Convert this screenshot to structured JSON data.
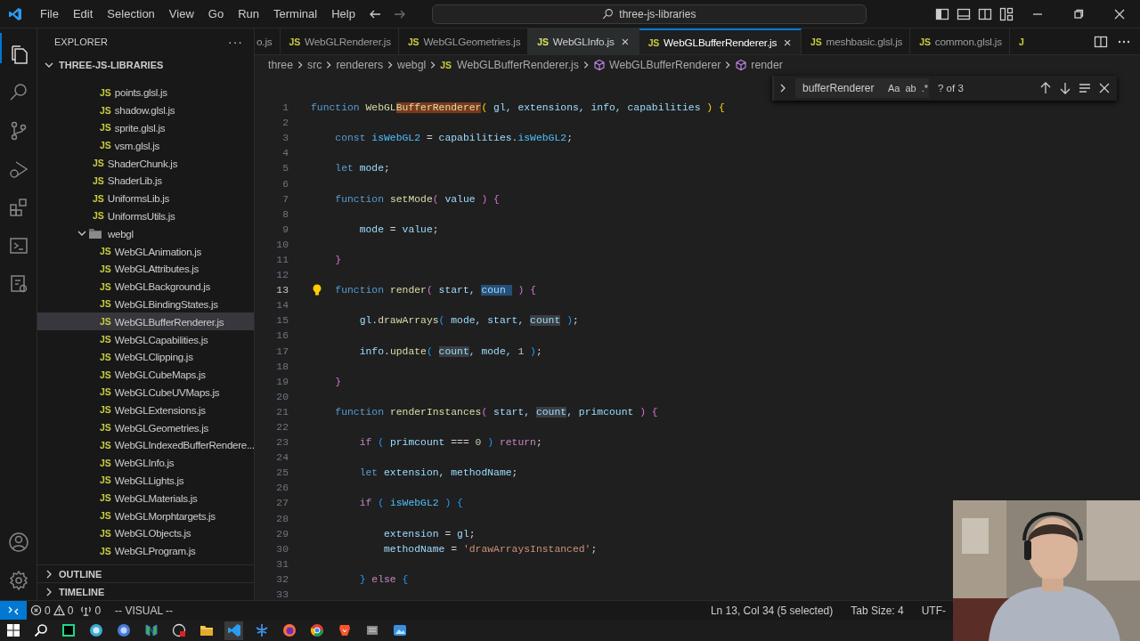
{
  "menu": [
    "File",
    "Edit",
    "Selection",
    "View",
    "Go",
    "Run",
    "Terminal",
    "Help"
  ],
  "command_center": {
    "label": "three-js-libraries"
  },
  "sidebar": {
    "title": "EXPLORER",
    "more": "···",
    "section": {
      "label": "THREE-JS-LIBRARIES",
      "expanded": true
    },
    "tree": [
      {
        "children": [
          {
            "name": "points.glsl.js",
            "badge": "JS",
            "selected": false
          },
          {
            "name": "shadow.glsl.js",
            "badge": "JS",
            "selected": false
          },
          {
            "name": "sprite.glsl.js",
            "badge": "JS",
            "selected": false
          },
          {
            "name": "vsm.glsl.js",
            "badge": "JS",
            "selected": false
          }
        ]
      },
      {
        "name": "ShaderChunk.js",
        "badge": "JS",
        "selected": false
      },
      {
        "name": "ShaderLib.js",
        "badge": "JS",
        "selected": false
      },
      {
        "name": "UniformsLib.js",
        "badge": "JS",
        "selected": false
      },
      {
        "name": "UniformsUtils.js",
        "badge": "JS",
        "selected": false
      },
      {
        "name": "webgl",
        "kind": "folder",
        "expanded": true,
        "selected": false,
        "children": [
          {
            "name": "WebGLAnimation.js",
            "badge": "JS",
            "selected": false
          },
          {
            "name": "WebGLAttributes.js",
            "badge": "JS",
            "selected": false
          },
          {
            "name": "WebGLBackground.js",
            "badge": "JS",
            "selected": false
          },
          {
            "name": "WebGLBindingStates.js",
            "badge": "JS",
            "selected": false
          },
          {
            "name": "WebGLBufferRenderer.js",
            "badge": "JS",
            "selected": true
          },
          {
            "name": "WebGLCapabilities.js",
            "badge": "JS",
            "selected": false
          },
          {
            "name": "WebGLClipping.js",
            "badge": "JS",
            "selected": false
          },
          {
            "name": "WebGLCubeMaps.js",
            "badge": "JS",
            "selected": false
          },
          {
            "name": "WebGLCubeUVMaps.js",
            "badge": "JS",
            "selected": false
          },
          {
            "name": "WebGLExtensions.js",
            "badge": "JS",
            "selected": false
          },
          {
            "name": "WebGLGeometries.js",
            "badge": "JS",
            "selected": false
          },
          {
            "name": "WebGLIndexedBufferRendere...",
            "badge": "JS",
            "selected": false
          },
          {
            "name": "WebGLInfo.js",
            "badge": "JS",
            "selected": false
          },
          {
            "name": "WebGLLights.js",
            "badge": "JS",
            "selected": false
          },
          {
            "name": "WebGLMaterials.js",
            "badge": "JS",
            "selected": false
          },
          {
            "name": "WebGLMorphtargets.js",
            "badge": "JS",
            "selected": false
          },
          {
            "name": "WebGLObjects.js",
            "badge": "JS",
            "selected": false
          },
          {
            "name": "WebGLProgram.js",
            "badge": "JS",
            "selected": false
          }
        ]
      }
    ],
    "panels": [
      {
        "label": "OUTLINE",
        "expanded": false
      },
      {
        "label": "TIMELINE",
        "expanded": false
      }
    ]
  },
  "tabs": [
    {
      "label": "o.js",
      "selected": false,
      "hovered": false
    },
    {
      "badge": "JS",
      "label": "WebGLRenderer.js",
      "selected": false,
      "hovered": false
    },
    {
      "badge": "JS",
      "label": "WebGLGeometries.js",
      "selected": false,
      "hovered": false
    },
    {
      "badge": "JS",
      "label": "WebGLInfo.js",
      "selected": false,
      "hovered": true,
      "close": "×"
    },
    {
      "badge": "JS",
      "label": "WebGLBufferRenderer.js",
      "selected": true,
      "hovered": false,
      "close": "×"
    },
    {
      "badge": "JS",
      "label": "meshbasic.glsl.js",
      "selected": false,
      "hovered": false
    },
    {
      "badge": "JS",
      "label": "common.glsl.js",
      "selected": false,
      "hovered": false
    },
    {
      "badge": "J",
      "selected": false,
      "hovered": false
    }
  ],
  "breadcrumbs": [
    {
      "kind": "folder",
      "label": "three"
    },
    {
      "kind": "folder",
      "label": "src"
    },
    {
      "kind": "folder",
      "label": "renderers"
    },
    {
      "kind": "folder",
      "label": "webgl"
    },
    {
      "kind": "file",
      "badge": "JS",
      "label": "WebGLBufferRenderer.js"
    },
    {
      "kind": "symbol",
      "label": "WebGLBufferRenderer"
    },
    {
      "kind": "symbol",
      "label": "render"
    }
  ],
  "find": {
    "value": "bufferRenderer",
    "options": [
      "Aa",
      "ab",
      ".*"
    ],
    "count": "? of 3"
  },
  "lines": [
    {
      "number": "1",
      "active": false,
      "tokens": [
        {
          "text": "function ",
          "kind": "kw"
        },
        {
          "text": "WebGL",
          "kind": "fn"
        },
        {
          "text": "BufferRenderer",
          "kind": "fn",
          "match": true
        },
        {
          "text": "(",
          "kind": "b1"
        },
        {
          "text": " gl, extensions, info, capabilities ",
          "kind": "var"
        },
        {
          "text": ") ",
          "kind": "b1"
        },
        {
          "text": "{",
          "kind": "b1"
        }
      ]
    },
    {
      "number": "2",
      "active": false
    },
    {
      "number": "3",
      "active": false,
      "tokens": [
        {
          "text": "    const ",
          "kind": "kw"
        },
        {
          "text": "isWebGL2",
          "kind": "const"
        },
        {
          "text": " = ",
          "kind": "plain"
        },
        {
          "text": "capabilities",
          "kind": "var"
        },
        {
          "text": ".",
          "kind": "plain"
        },
        {
          "text": "isWebGL2",
          "kind": "const"
        },
        {
          "text": ";",
          "kind": "plain"
        }
      ]
    },
    {
      "number": "4",
      "active": false
    },
    {
      "number": "5",
      "active": false,
      "tokens": [
        {
          "text": "    let ",
          "kind": "kw"
        },
        {
          "text": "mode",
          "kind": "var"
        },
        {
          "text": ";",
          "kind": "plain"
        }
      ]
    },
    {
      "number": "6",
      "active": false
    },
    {
      "number": "7",
      "active": false,
      "tokens": [
        {
          "text": "    function ",
          "kind": "kw"
        },
        {
          "text": "setMode",
          "kind": "fn"
        },
        {
          "text": "(",
          "kind": "b2"
        },
        {
          "text": " value ",
          "kind": "var"
        },
        {
          "text": ") ",
          "kind": "b2"
        },
        {
          "text": "{",
          "kind": "b2"
        }
      ]
    },
    {
      "number": "8",
      "active": false
    },
    {
      "number": "9",
      "active": false,
      "tokens": [
        {
          "text": "        mode",
          "kind": "var"
        },
        {
          "text": " = ",
          "kind": "plain"
        },
        {
          "text": "value",
          "kind": "var"
        },
        {
          "text": ";",
          "kind": "plain"
        }
      ]
    },
    {
      "number": "10",
      "active": false
    },
    {
      "number": "11",
      "active": false,
      "tokens": [
        {
          "text": "    }",
          "kind": "b2"
        }
      ]
    },
    {
      "number": "12",
      "active": false
    },
    {
      "number": "13",
      "active": true,
      "tokens": [
        {
          "text": "    function ",
          "kind": "kw"
        },
        {
          "text": "render",
          "kind": "fn"
        },
        {
          "text": "(",
          "kind": "b2"
        },
        {
          "text": " start, ",
          "kind": "var"
        },
        {
          "text": "coun ",
          "kind": "var",
          "selected": true
        },
        {
          "text": " ) ",
          "kind": "b2"
        },
        {
          "text": "{",
          "kind": "b2"
        }
      ]
    },
    {
      "number": "14",
      "active": false
    },
    {
      "number": "15",
      "active": false,
      "tokens": [
        {
          "text": "        gl",
          "kind": "var"
        },
        {
          "text": ".",
          "kind": "plain"
        },
        {
          "text": "drawArrays",
          "kind": "fn"
        },
        {
          "text": "(",
          "kind": "b3"
        },
        {
          "text": " mode, start, ",
          "kind": "var"
        },
        {
          "text": "count",
          "kind": "var",
          "occurrence": true
        },
        {
          "text": " )",
          "kind": "b3"
        },
        {
          "text": ";",
          "kind": "plain"
        }
      ]
    },
    {
      "number": "16",
      "active": false
    },
    {
      "number": "17",
      "active": false,
      "tokens": [
        {
          "text": "        info",
          "kind": "var"
        },
        {
          "text": ".",
          "kind": "plain"
        },
        {
          "text": "update",
          "kind": "fn"
        },
        {
          "text": "( ",
          "kind": "b3"
        },
        {
          "text": "count",
          "kind": "var",
          "occurrence": true
        },
        {
          "text": ", mode, ",
          "kind": "var"
        },
        {
          "text": "1 ",
          "kind": "num"
        },
        {
          "text": ")",
          "kind": "b3"
        },
        {
          "text": ";",
          "kind": "plain"
        }
      ]
    },
    {
      "number": "18",
      "active": false
    },
    {
      "number": "19",
      "active": false,
      "tokens": [
        {
          "text": "    }",
          "kind": "b2"
        }
      ]
    },
    {
      "number": "20",
      "active": false
    },
    {
      "number": "21",
      "active": false,
      "tokens": [
        {
          "text": "    function ",
          "kind": "kw"
        },
        {
          "text": "renderInstances",
          "kind": "fn"
        },
        {
          "text": "(",
          "kind": "b2"
        },
        {
          "text": " start, ",
          "kind": "var"
        },
        {
          "text": "count",
          "kind": "var",
          "occurrence": true
        },
        {
          "text": ", primcount ",
          "kind": "var"
        },
        {
          "text": ") ",
          "kind": "b2"
        },
        {
          "text": "{",
          "kind": "b2"
        }
      ]
    },
    {
      "number": "22",
      "active": false
    },
    {
      "number": "23",
      "active": false,
      "tokens": [
        {
          "text": "        if ",
          "kind": "ctrl"
        },
        {
          "text": "( ",
          "kind": "b3"
        },
        {
          "text": "primcount ",
          "kind": "var"
        },
        {
          "text": "=== ",
          "kind": "plain"
        },
        {
          "text": "0 ",
          "kind": "num"
        },
        {
          "text": ") ",
          "kind": "b3"
        },
        {
          "text": "return",
          "kind": "ctrl"
        },
        {
          "text": ";",
          "kind": "plain"
        }
      ]
    },
    {
      "number": "24",
      "active": false
    },
    {
      "number": "25",
      "active": false,
      "tokens": [
        {
          "text": "        let",
          "kind": "kw"
        },
        {
          "text": " extension, methodName",
          "kind": "var"
        },
        {
          "text": ";",
          "kind": "plain"
        }
      ]
    },
    {
      "number": "26",
      "active": false
    },
    {
      "number": "27",
      "active": false,
      "tokens": [
        {
          "text": "        if ",
          "kind": "ctrl"
        },
        {
          "text": "( ",
          "kind": "b3"
        },
        {
          "text": "isWebGL2 ",
          "kind": "const"
        },
        {
          "text": ") ",
          "kind": "b3"
        },
        {
          "text": "{",
          "kind": "b3"
        }
      ]
    },
    {
      "number": "28",
      "active": false
    },
    {
      "number": "29",
      "active": false,
      "tokens": [
        {
          "text": "            extension",
          "kind": "var"
        },
        {
          "text": " = ",
          "kind": "plain"
        },
        {
          "text": "gl",
          "kind": "var"
        },
        {
          "text": ";",
          "kind": "plain"
        }
      ]
    },
    {
      "number": "30",
      "active": false,
      "tokens": [
        {
          "text": "            methodName",
          "kind": "var"
        },
        {
          "text": " = ",
          "kind": "plain"
        },
        {
          "text": "'drawArraysInstanced'",
          "kind": "str"
        },
        {
          "text": ";",
          "kind": "plain"
        }
      ]
    },
    {
      "number": "31",
      "active": false
    },
    {
      "number": "32",
      "active": false,
      "tokens": [
        {
          "text": "        } ",
          "kind": "b3"
        },
        {
          "text": "else ",
          "kind": "ctrl"
        },
        {
          "text": "{",
          "kind": "b3"
        }
      ]
    },
    {
      "number": "33",
      "active": false
    }
  ],
  "status_bar": {
    "errors": "0",
    "warnings": "0",
    "ports": "0",
    "mode": "-- VISUAL --",
    "position": "Ln 13, Col 34 (5 selected)",
    "tab_size": "Tab Size: 4",
    "encoding": "UTF-"
  },
  "webcam": {
    "kind": "picture"
  }
}
